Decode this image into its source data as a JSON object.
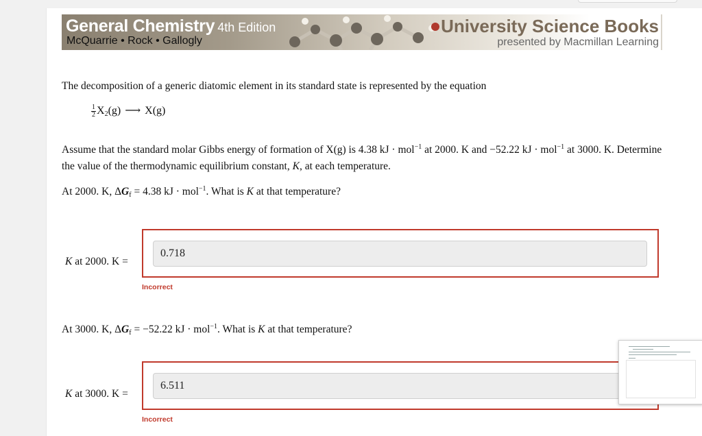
{
  "banner": {
    "book_title": "General Chemistry",
    "book_edition": "4th Edition",
    "book_authors": "McQuarrie • Rock • Gallogly",
    "publisher": "University Science Books",
    "publisher_sub": "presented by Macmillan Learning"
  },
  "question": {
    "intro": "The decomposition of a generic diatomic element in its standard state is represented by the equation",
    "eq_frac_num": "1",
    "eq_frac_den": "2",
    "eq_reactant": "X",
    "eq_reactant_sub": "2",
    "eq_reactant_state": "(g)",
    "eq_arrow": "⟶",
    "eq_product": "X(g)",
    "assume_a": "Assume that the standard molar Gibbs energy of formation of X(g) is 4.38 kJ · mol",
    "assume_a_sup": "−1",
    "assume_b": " at 2000. K and −52.22 kJ · mol",
    "assume_b_sup": "−1",
    "assume_c": " at 3000. K. Determine the value of the thermodynamic equilibrium constant, ",
    "assume_k": "K",
    "assume_d": ", at each temperature."
  },
  "parts": [
    {
      "prompt_a": "At 2000. K, Δ",
      "prompt_g": "G",
      "prompt_sub": "f",
      "prompt_b": " = 4.38 kJ · mol",
      "prompt_sup": "−1",
      "prompt_c": ". What is ",
      "prompt_k": "K",
      "prompt_d": " at that temperature?",
      "label_k": "K",
      "label_rest": " at 2000. K =",
      "answer": "0.718",
      "feedback": "Incorrect"
    },
    {
      "prompt_a": "At 3000. K, Δ",
      "prompt_g": "G",
      "prompt_sub": "f",
      "prompt_b": " = −52.22 kJ · mol",
      "prompt_sup": "−1",
      "prompt_c": ". What is ",
      "prompt_k": "K",
      "prompt_d": " at that temperature?",
      "label_k": "K",
      "label_rest": " at 3000. K =",
      "answer": "6.511",
      "feedback": "Incorrect"
    }
  ],
  "colors": {
    "error": "#c0392b",
    "publisher_brown": "#7a6a58"
  }
}
